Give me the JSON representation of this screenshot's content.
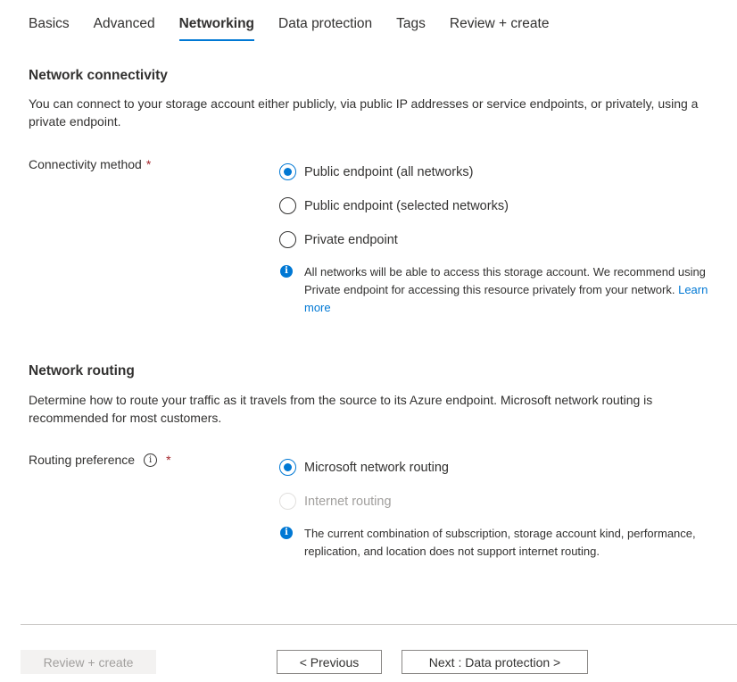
{
  "tabs": [
    {
      "label": "Basics",
      "active": false
    },
    {
      "label": "Advanced",
      "active": false
    },
    {
      "label": "Networking",
      "active": true
    },
    {
      "label": "Data protection",
      "active": false
    },
    {
      "label": "Tags",
      "active": false
    },
    {
      "label": "Review + create",
      "active": false
    }
  ],
  "network_connectivity": {
    "title": "Network connectivity",
    "description": "You can connect to your storage account either publicly, via public IP addresses or service endpoints, or privately, using a private endpoint.",
    "field_label": "Connectivity method",
    "required_mark": "*",
    "options": [
      {
        "label": "Public endpoint (all networks)",
        "checked": true,
        "disabled": false
      },
      {
        "label": "Public endpoint (selected networks)",
        "checked": false,
        "disabled": false
      },
      {
        "label": "Private endpoint",
        "checked": false,
        "disabled": false
      }
    ],
    "info_text": "All networks will be able to access this storage account. We recommend using Private endpoint for accessing this resource privately from your network.",
    "info_link": "Learn more"
  },
  "network_routing": {
    "title": "Network routing",
    "description": "Determine how to route your traffic as it travels from the source to its Azure endpoint. Microsoft network routing is recommended for most customers.",
    "field_label": "Routing preference",
    "info_glyph": "i",
    "required_mark": "*",
    "options": [
      {
        "label": "Microsoft network routing",
        "checked": true,
        "disabled": false
      },
      {
        "label": "Internet routing",
        "checked": false,
        "disabled": true
      }
    ],
    "info_text": "The current combination of subscription, storage account kind, performance, replication, and location does not support internet routing."
  },
  "footer": {
    "review_create_label": "Review + create",
    "previous_label": "< Previous",
    "next_label": "Next : Data protection >"
  },
  "colors": {
    "accent": "#0078d4",
    "required": "#a4262c",
    "disabled": "#a19f9d"
  },
  "icons": {
    "info_filled": "info-icon",
    "info_outline": "info-outline-icon"
  }
}
